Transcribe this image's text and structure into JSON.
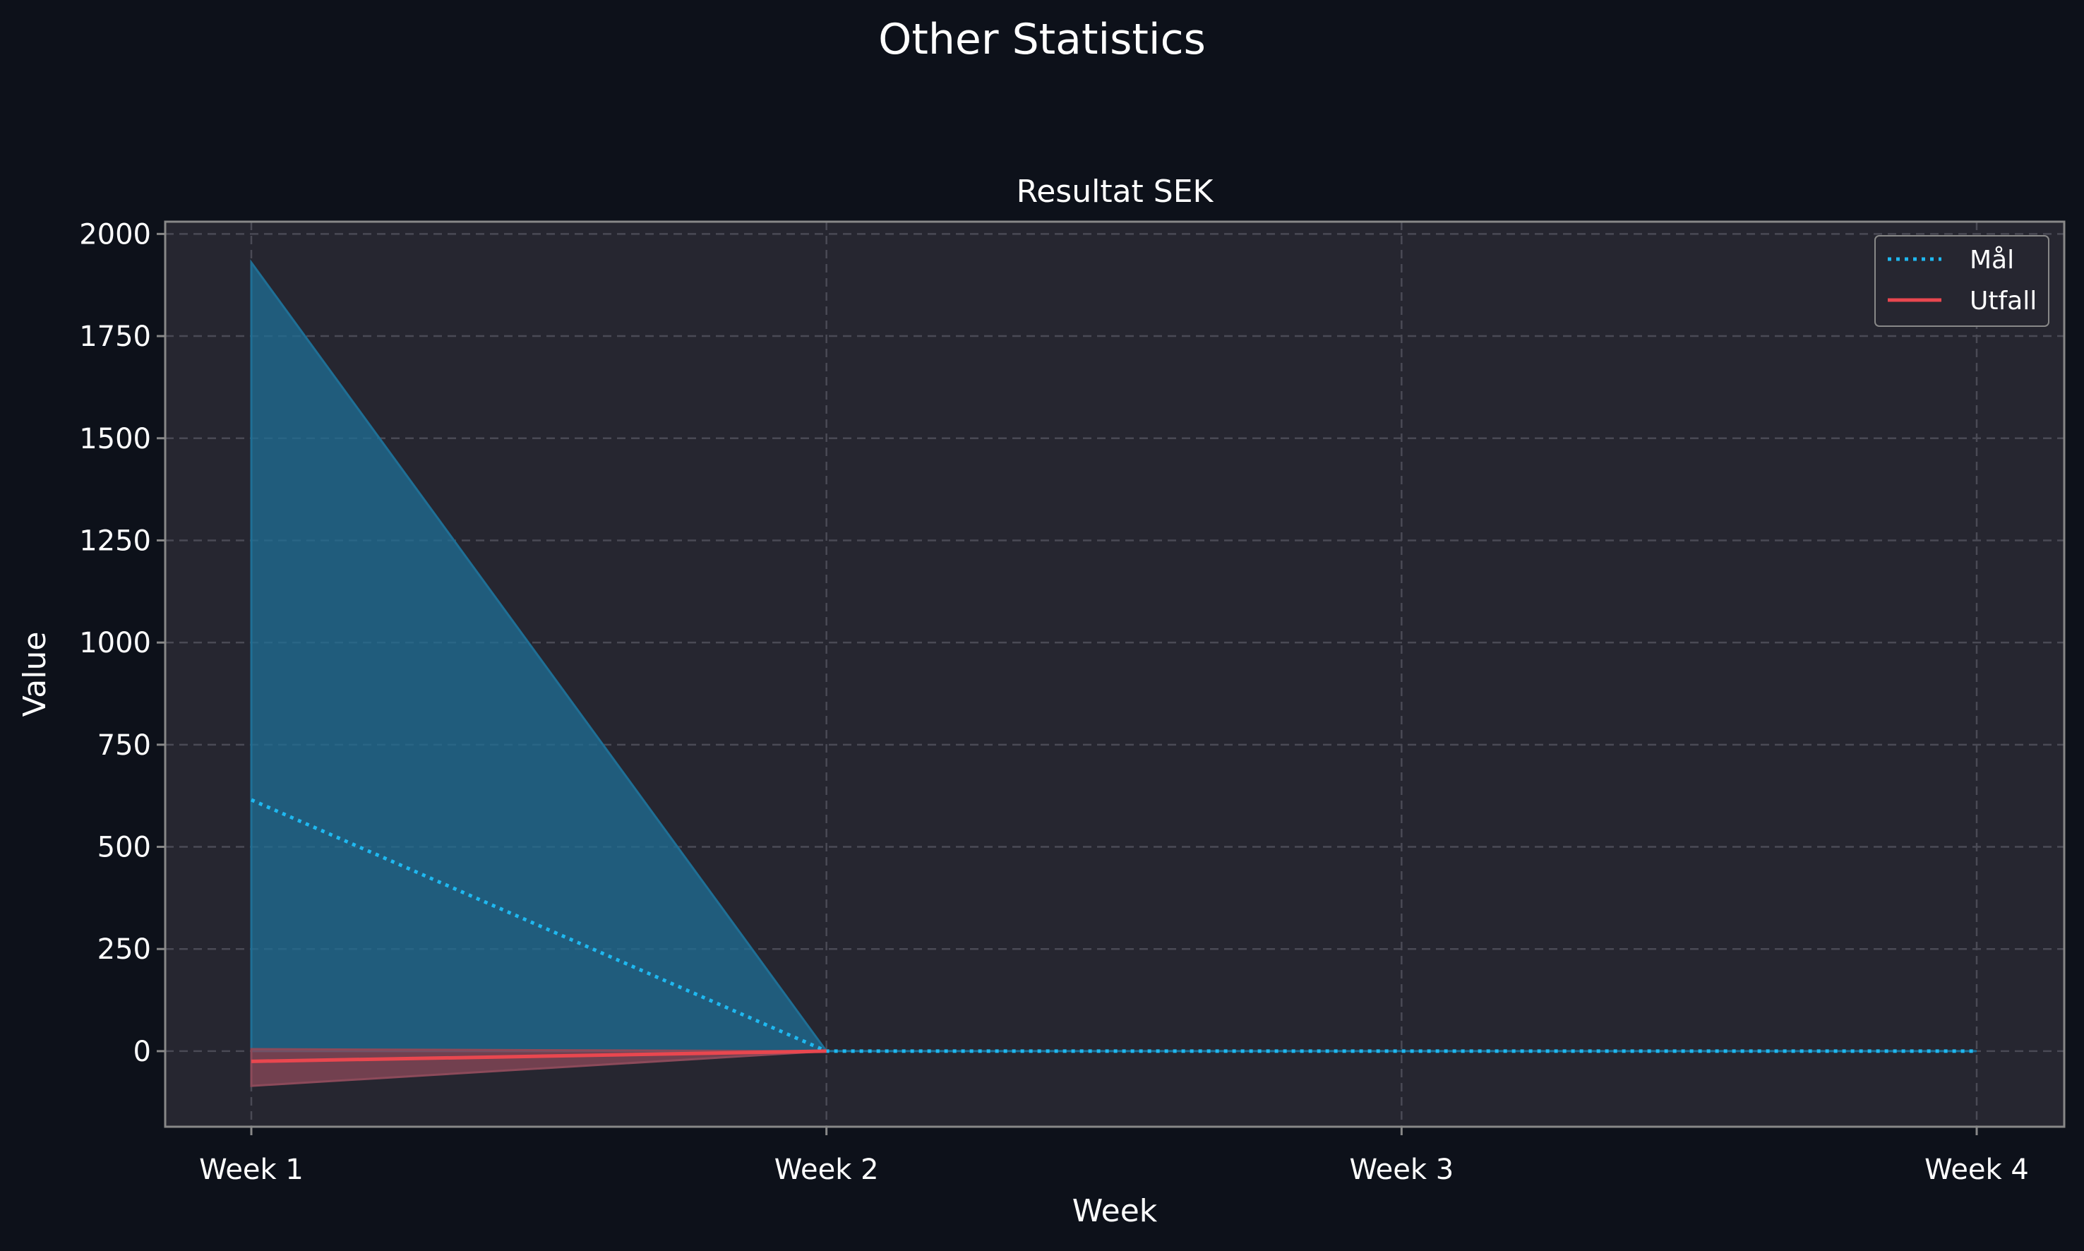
{
  "chart_data": {
    "type": "line",
    "suptitle": "Other Statistics",
    "title": "Resultat SEK",
    "xlabel": "Week",
    "ylabel": "Value",
    "categories": [
      "Week 1",
      "Week 2",
      "Week 3",
      "Week 4"
    ],
    "ylim": [
      -185,
      2030
    ],
    "yticks": [
      0,
      250,
      500,
      750,
      1000,
      1250,
      1500,
      1750,
      2000
    ],
    "grid": true,
    "legend_position": "top-right",
    "series": [
      {
        "name": "Mål",
        "values": [
          615,
          0,
          0,
          0
        ],
        "band_lower": [
          0,
          0,
          0,
          0
        ],
        "band_upper": [
          1930,
          0,
          0,
          0
        ],
        "color": "#1fb8f0",
        "band_color": "#1f6f95",
        "style": "dotted"
      },
      {
        "name": "Utfall",
        "values": [
          -25,
          0,
          null,
          null
        ],
        "band_lower": [
          -85,
          0,
          null,
          null
        ],
        "band_upper": [
          5,
          0,
          null,
          null
        ],
        "color": "#e9474f",
        "band_color": "#8c4a5a",
        "style": "solid"
      }
    ],
    "colors": {
      "figure_background": "#0d111a",
      "plot_background": "#262630",
      "spine": "#888888",
      "grid": "#4a4a55",
      "text": "#ffffff"
    }
  }
}
